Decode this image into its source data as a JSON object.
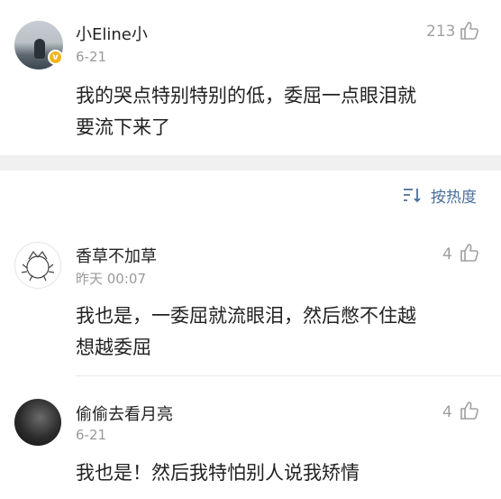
{
  "post": {
    "author": "小Eline小",
    "date": "6-21",
    "likes": "213",
    "text_line1": "我的哭点特别特别的低，委屈一点眼泪就",
    "text_line2": "要流下来了"
  },
  "sort": {
    "label": "按热度"
  },
  "comments": [
    {
      "author": "香草不加草",
      "date": "昨天 00:07",
      "likes": "4",
      "text_line1": "我也是，一委屈就流眼泪，然后憋不住越",
      "text_line2": "想越委屈"
    },
    {
      "author": "偷偷去看月亮",
      "date": "6-21",
      "likes": "4",
      "text_line1": "我也是！然后我特怕别人说我矫情"
    }
  ],
  "colors": {
    "link": "#4a6f99",
    "verified_badge": "#f5b417",
    "secondary_text": "#9a9a9a",
    "divider": "#f0f0f0"
  }
}
